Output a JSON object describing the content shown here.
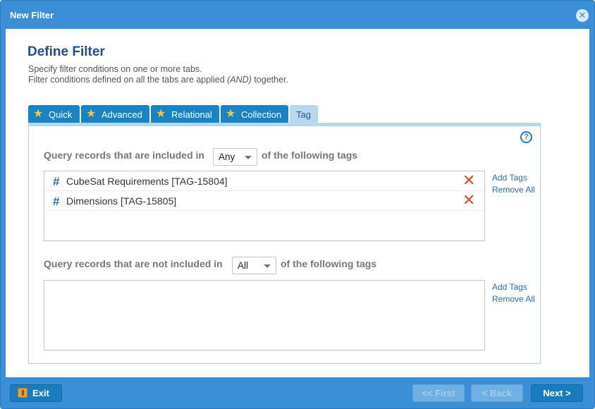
{
  "window": {
    "title": "New Filter",
    "close_icon": "close-icon"
  },
  "content": {
    "heading": "Define Filter",
    "description_line1": "Specify filter conditions on one or more tabs.",
    "description_line2_pre": "Filter conditions defined on all the tabs are applied ",
    "description_line2_em": "(AND)",
    "description_line2_post": " together."
  },
  "tabs": [
    {
      "label": "Quick",
      "icon": "star-icon",
      "active": false
    },
    {
      "label": "Advanced",
      "icon": "star-icon",
      "active": false
    },
    {
      "label": "Relational",
      "icon": "star-icon",
      "active": false
    },
    {
      "label": "Collection",
      "icon": "star-icon",
      "active": false
    },
    {
      "label": "Tag",
      "active": true
    }
  ],
  "included": {
    "label_pre": "Query records that are included in",
    "selected": "Any",
    "label_post": "of the following tags",
    "tags": [
      {
        "name": "CubeSat Requirements [TAG-15804]"
      },
      {
        "name": "Dimensions [TAG-15805]"
      }
    ],
    "add_link": "Add Tags",
    "remove_link": "Remove All"
  },
  "excluded": {
    "label_pre": "Query records that are not included in",
    "selected": "All",
    "label_post": "of the following tags",
    "tags": [],
    "add_link": "Add Tags",
    "remove_link": "Remove All"
  },
  "footer": {
    "exit_label": "Exit",
    "first_label": "<< First",
    "back_label": "< Back",
    "next_label": "Next >"
  },
  "colors": {
    "title_bar": "#3a8fd6",
    "tab": "#1a83c5",
    "tab_active": "#b8d8f0",
    "heading": "#1e4f87",
    "remove": "#e04a2c"
  }
}
